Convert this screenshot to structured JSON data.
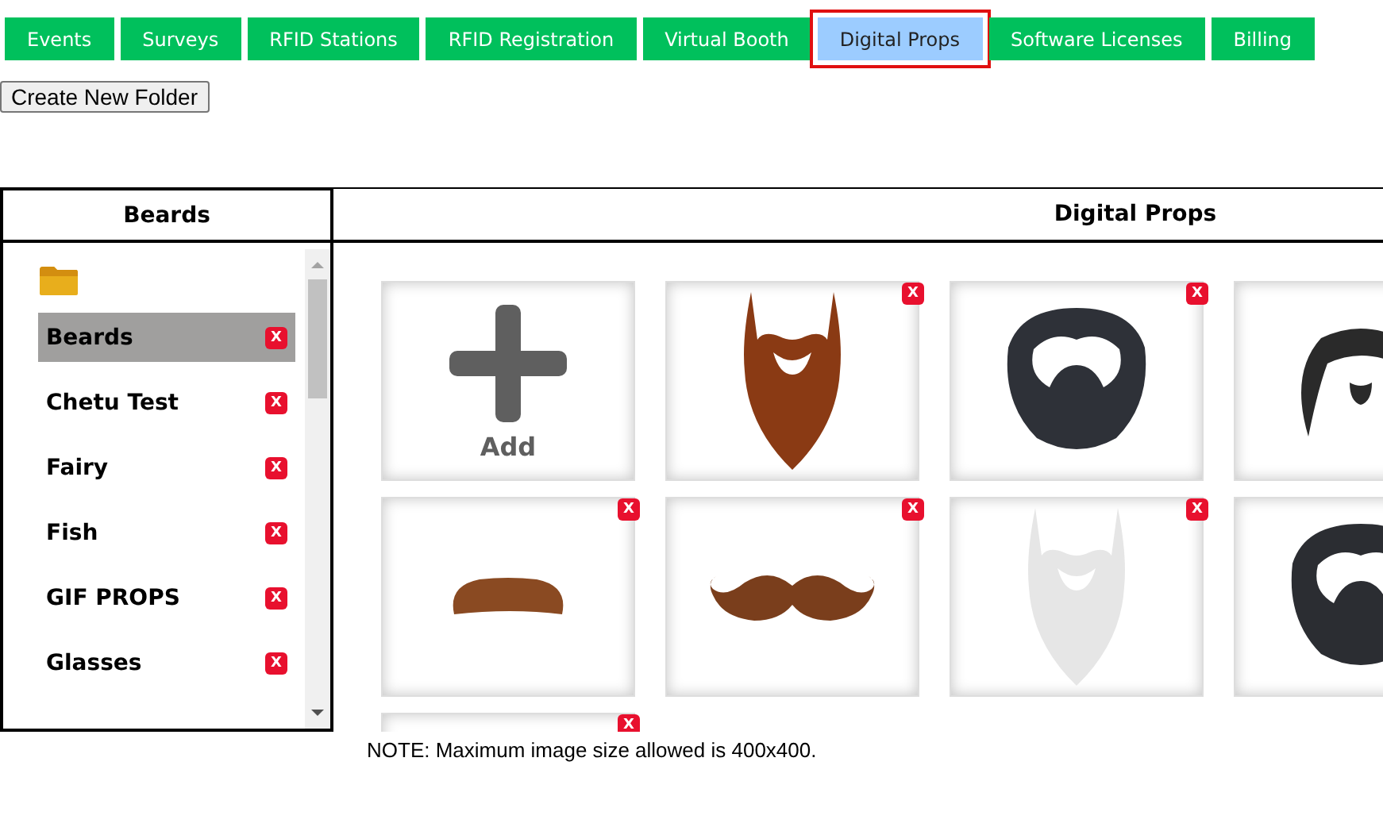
{
  "tabs": [
    {
      "label": "Events",
      "selected": false
    },
    {
      "label": "Surveys",
      "selected": false
    },
    {
      "label": "RFID Stations",
      "selected": false
    },
    {
      "label": "RFID Registration",
      "selected": false
    },
    {
      "label": "Virtual Booth",
      "selected": false
    },
    {
      "label": "Digital Props",
      "selected": true
    },
    {
      "label": "Software Licenses",
      "selected": false
    },
    {
      "label": "Billing",
      "selected": false
    }
  ],
  "create_folder_button": "Create New Folder",
  "folders": {
    "heading": "Beards",
    "items": [
      {
        "label": "Beards",
        "selected": true,
        "delete_label": "X"
      },
      {
        "label": "Chetu Test",
        "selected": false,
        "delete_label": "X"
      },
      {
        "label": "Fairy",
        "selected": false,
        "delete_label": "X"
      },
      {
        "label": "Fish",
        "selected": false,
        "delete_label": "X"
      },
      {
        "label": "GIF PROPS",
        "selected": false,
        "delete_label": "X"
      },
      {
        "label": "Glasses",
        "selected": false,
        "delete_label": "X"
      }
    ]
  },
  "props": {
    "heading": "Digital Props",
    "items": [
      {
        "kind": "add",
        "label": "Add"
      },
      {
        "kind": "beard",
        "color": "#8a3a14",
        "delete_label": "X"
      },
      {
        "kind": "full-beard",
        "color": "#2e3138",
        "delete_label": "X"
      },
      {
        "kind": "long-beard",
        "color": "#2a2a2a"
      },
      {
        "kind": "mustache",
        "color": "#8a4a22",
        "delete_label": "X"
      },
      {
        "kind": "curled-mustache",
        "color": "#7a3e1c",
        "delete_label": "X"
      },
      {
        "kind": "beard",
        "color": "#e6e6e6",
        "delete_label": "X"
      },
      {
        "kind": "full-beard",
        "color": "#2b2d32"
      },
      {
        "kind": "blank",
        "delete_label": "X"
      }
    ]
  },
  "note": "NOTE: Maximum image size allowed is 400x400."
}
